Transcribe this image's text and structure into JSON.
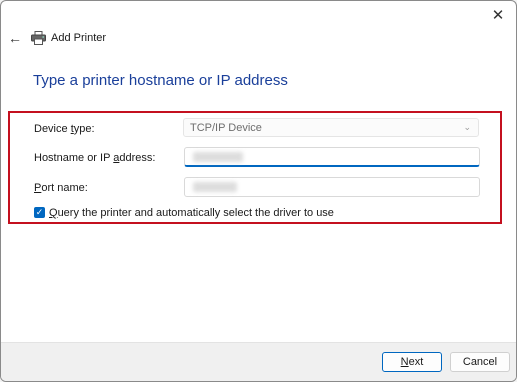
{
  "window": {
    "title": "Add Printer",
    "close_glyph": "✕",
    "back_glyph": "←"
  },
  "page": {
    "heading": "Type a printer hostname or IP address"
  },
  "form": {
    "device_type": {
      "label_pre": "Device ",
      "label_mnemonic": "t",
      "label_post": "ype:",
      "value": "TCP/IP Device",
      "disabled": true
    },
    "hostname": {
      "label_pre": "Hostname or IP ",
      "label_mnemonic": "a",
      "label_post": "ddress:",
      "value_redacted": true,
      "focused": true
    },
    "port_name": {
      "label_pre": "",
      "label_mnemonic": "P",
      "label_post": "ort name:",
      "value_redacted": true
    },
    "query_printer": {
      "label_pre": "",
      "label_mnemonic": "Q",
      "label_post": "uery the printer and automatically select the driver to use",
      "checked": true
    }
  },
  "footer": {
    "next": {
      "mnemonic": "N",
      "rest": "ext"
    },
    "cancel": "Cancel"
  },
  "colors": {
    "accent": "#0067c0",
    "heading": "#1a3f9a",
    "highlight_border": "#c4101f"
  },
  "icons": [
    "close-icon",
    "back-arrow-icon",
    "printer-icon",
    "chevron-down-icon",
    "checkmark-icon"
  ]
}
